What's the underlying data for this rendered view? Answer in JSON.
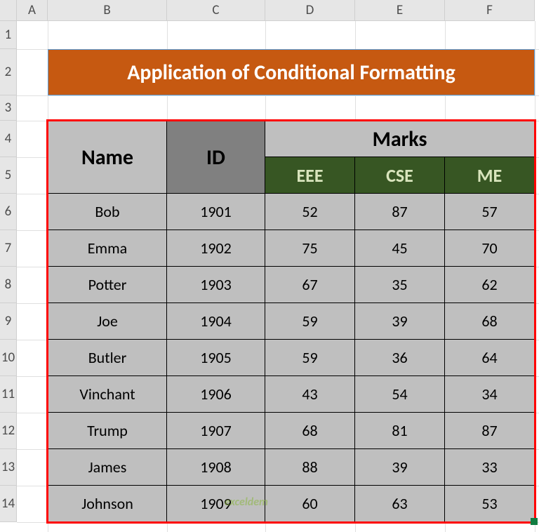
{
  "columns": {
    "A": "A",
    "B": "B",
    "C": "C",
    "D": "D",
    "E": "E",
    "F": "F"
  },
  "rows": [
    "1",
    "2",
    "3",
    "4",
    "5",
    "6",
    "7",
    "8",
    "9",
    "10",
    "11",
    "12",
    "13",
    "14"
  ],
  "title": "Application of Conditional Formatting",
  "headers": {
    "name": "Name",
    "id": "ID",
    "marks": "Marks",
    "eee": "EEE",
    "cse": "CSE",
    "me": "ME"
  },
  "chart_data": {
    "type": "table",
    "title": "Application of Conditional Formatting",
    "columns": [
      "Name",
      "ID",
      "EEE",
      "CSE",
      "ME"
    ],
    "rows": [
      {
        "name": "Bob",
        "id": "1901",
        "eee": "52",
        "cse": "87",
        "me": "57"
      },
      {
        "name": "Emma",
        "id": "1902",
        "eee": "75",
        "cse": "45",
        "me": "70"
      },
      {
        "name": "Potter",
        "id": "1903",
        "eee": "67",
        "cse": "35",
        "me": "62"
      },
      {
        "name": "Joe",
        "id": "1904",
        "eee": "59",
        "cse": "39",
        "me": "68"
      },
      {
        "name": "Butler",
        "id": "1905",
        "eee": "59",
        "cse": "36",
        "me": "64"
      },
      {
        "name": "Vinchant",
        "id": "1906",
        "eee": "43",
        "cse": "54",
        "me": "34"
      },
      {
        "name": "Trump",
        "id": "1907",
        "eee": "68",
        "cse": "81",
        "me": "87"
      },
      {
        "name": "James",
        "id": "1908",
        "eee": "88",
        "cse": "39",
        "me": "33"
      },
      {
        "name": "Johnson",
        "id": "1909",
        "eee": "60",
        "cse": "63",
        "me": "53"
      }
    ]
  },
  "watermark": "exceldem"
}
